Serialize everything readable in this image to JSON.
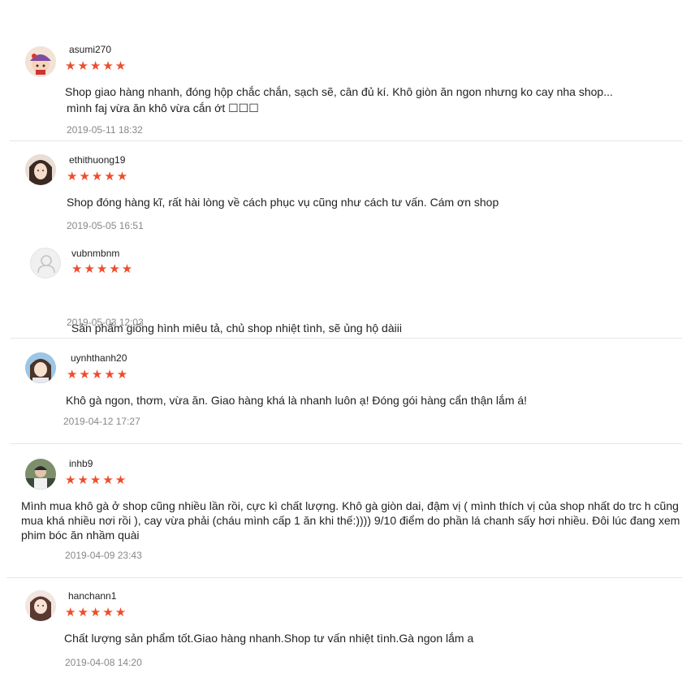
{
  "reviews": [
    {
      "username": "asumi270",
      "stars": "★★★★★",
      "comment_lines": [
        "Shop giao hàng nhanh, đóng hộp chắc chắn, sạch sẽ, cân đủ kí. Khô giòn ăn ngon nhưng ko cay nha shop...",
        "mình faj vừa ăn khô vừa cắn ớt ☐☐☐"
      ],
      "date": "2019-05-11 18:32"
    },
    {
      "username": "ethithuong19",
      "stars": "★★★★★",
      "comment_lines": [
        "Shop đóng hàng kĩ, rất hài lòng về cách phục vụ cũng như cách tư vấn. Cám ơn shop"
      ],
      "date": "2019-05-05 16:51"
    },
    {
      "username": "vubnmbnm",
      "stars": "★★★★★",
      "comment_lines": [
        " Sản phẩm giống hình miêu tả, chủ shop nhiệt tình, sẽ ủng hộ dàiii"
      ],
      "date": "2019-05-03 12:03"
    },
    {
      "username": "uynhthanh20",
      "stars": "★★★★★",
      "comment_lines": [
        "Khô gà ngon, thơm, vừa ăn. Giao hàng khá là nhanh luôn ạ! Đóng gói hàng cẩn thận lắm á!"
      ],
      "date": "2019-04-12 17:27"
    },
    {
      "username": "inhb9",
      "stars": "★★★★★",
      "comment_lines": [
        "Mình mua khô gà ở shop cũng nhiều lần rồi, cực kì chất lượng. Khô gà giòn dai, đậm vị ( mình thích vị của shop nhất do trc h cũng",
        "mua khá nhiều nơi rồi ), cay vừa phải (cháu mình cấp 1 ăn khi thế:)))) 9/10 điểm do phần lá chanh sấy hơi nhiều. Đôi lúc đang xem",
        "phim bóc ăn nhầm quài"
      ],
      "date": "2019-04-09 23:43"
    },
    {
      "username": "hanchann1",
      "stars": "★★★★★",
      "comment_lines": [
        "Chất lượng sản phẩm tốt.Giao hàng nhanh.Shop tư vấn nhiệt tình.Gà ngon lắm a"
      ],
      "date": "2019-04-08 14:20"
    }
  ]
}
